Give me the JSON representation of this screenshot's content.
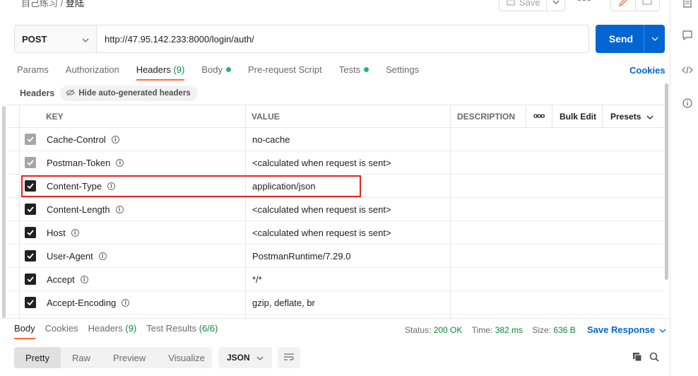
{
  "breadcrumb": {
    "parent": "自己练习",
    "separator": "/",
    "current": "登陆"
  },
  "toolbar": {
    "save_label": "Save",
    "more": "ooo"
  },
  "request": {
    "method": "POST",
    "url": "http://47.95.142.233:8000/login/auth/",
    "send_label": "Send"
  },
  "request_tabs": [
    {
      "label": "Params"
    },
    {
      "label": "Authorization"
    },
    {
      "label": "Headers",
      "count": "(9)"
    },
    {
      "label": "Body"
    },
    {
      "label": "Pre-request Script"
    },
    {
      "label": "Tests"
    },
    {
      "label": "Settings"
    }
  ],
  "cookies_link": "Cookies",
  "headers_section": {
    "title": "Headers",
    "hide_label": "Hide auto-generated headers"
  },
  "table": {
    "columns": {
      "key": "KEY",
      "value": "VALUE",
      "description": "DESCRIPTION",
      "more": "ooo",
      "bulk_edit": "Bulk Edit",
      "presets": "Presets"
    },
    "rows": [
      {
        "key": "Cache-Control",
        "value": "no-cache",
        "checked": true,
        "dim": true
      },
      {
        "key": "Postman-Token",
        "value": "<calculated when request is sent>",
        "checked": true,
        "dim": true
      },
      {
        "key": "Content-Type",
        "value": "application/json",
        "checked": true,
        "dim": false
      },
      {
        "key": "Content-Length",
        "value": "<calculated when request is sent>",
        "checked": true,
        "dim": false
      },
      {
        "key": "Host",
        "value": "<calculated when request is sent>",
        "checked": true,
        "dim": false
      },
      {
        "key": "User-Agent",
        "value": "PostmanRuntime/7.29.0",
        "checked": true,
        "dim": false
      },
      {
        "key": "Accept",
        "value": "*/*",
        "checked": true,
        "dim": false
      },
      {
        "key": "Accept-Encoding",
        "value": "gzip, deflate, br",
        "checked": true,
        "dim": false
      }
    ]
  },
  "response_tabs": [
    {
      "label": "Body"
    },
    {
      "label": "Cookies"
    },
    {
      "label": "Headers",
      "count": "(9)"
    },
    {
      "label": "Test Results",
      "count": "(6/6)"
    }
  ],
  "response_status": {
    "status_label": "Status:",
    "status_value": "200 OK",
    "time_label": "Time:",
    "time_value": "382 ms",
    "size_label": "Size:",
    "size_value": "636 B",
    "save_response": "Save Response"
  },
  "format_options": [
    "Pretty",
    "Raw",
    "Preview",
    "Visualize"
  ],
  "language": "JSON",
  "colors": {
    "accent": "#ff6c37",
    "primary": "#0265d2",
    "success": "#0a8a3a",
    "highlight_box": "#e5231f"
  }
}
